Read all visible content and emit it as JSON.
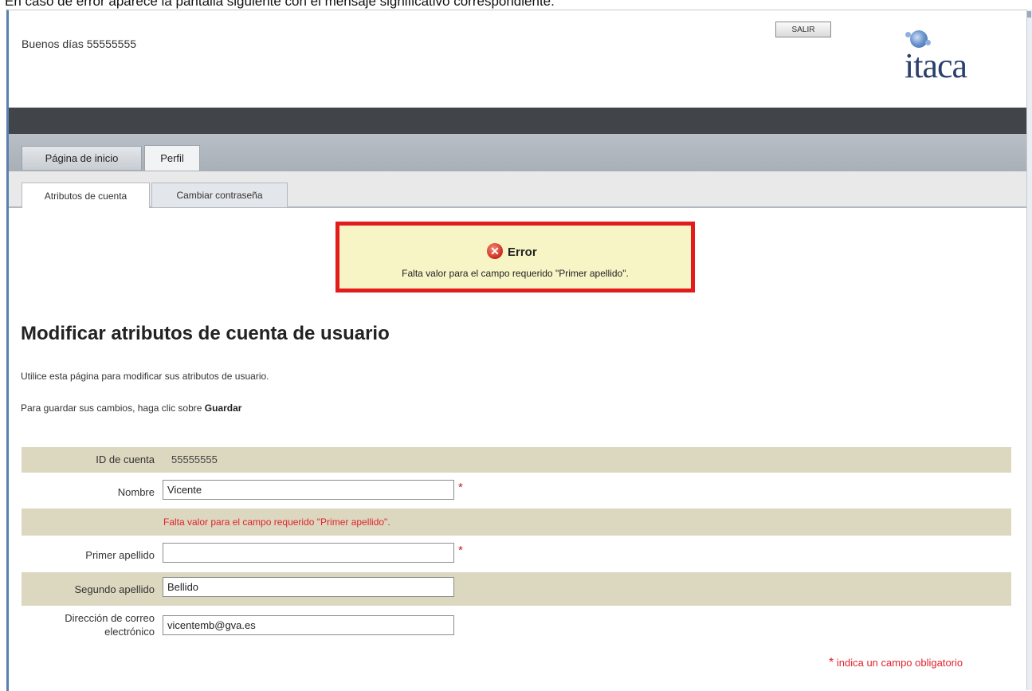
{
  "caption": "En caso de error aparece la pantalla siguiente con el mensaje significativo correspondiente.",
  "header": {
    "greeting": "Buenos días 55555555",
    "logout_label": "SALIR",
    "logo_text": "itaca"
  },
  "tabs": [
    {
      "label": "Página de inicio"
    },
    {
      "label": "Perfil"
    }
  ],
  "subtabs": [
    {
      "label": "Atributos de cuenta"
    },
    {
      "label": "Cambiar contraseña"
    }
  ],
  "error_box": {
    "title": "Error",
    "message": "Falta valor para el campo requerido \"Primer apellido\"."
  },
  "page": {
    "title": "Modificar atributos de cuenta de usuario",
    "intro": "Utilice esta página para modificar sus atributos de usuario.",
    "save_hint_prefix": "Para guardar sus cambios, haga clic sobre ",
    "save_hint_bold": "Guardar"
  },
  "form": {
    "account_id_label": "ID de cuenta",
    "account_id_value": "55555555",
    "nombre_label": "Nombre",
    "nombre_value": "Vicente",
    "field_error": "Falta valor para el campo requerido \"Primer apellido\".",
    "apellido1_label": "Primer apellido",
    "apellido1_value": "",
    "apellido2_label": "Segundo apellido",
    "apellido2_value": "Bellido",
    "email_label_line1": "Dirección de correo",
    "email_label_line2": "electrónico",
    "email_value": "vicentemb@gva.es",
    "required_mark": "*",
    "legend_text": "indica un campo obligatorio"
  },
  "colors": {
    "error_border": "#e21b1b",
    "error_bg": "#f7f4c6",
    "required": "#e0232f",
    "header_bar": "#414448"
  }
}
